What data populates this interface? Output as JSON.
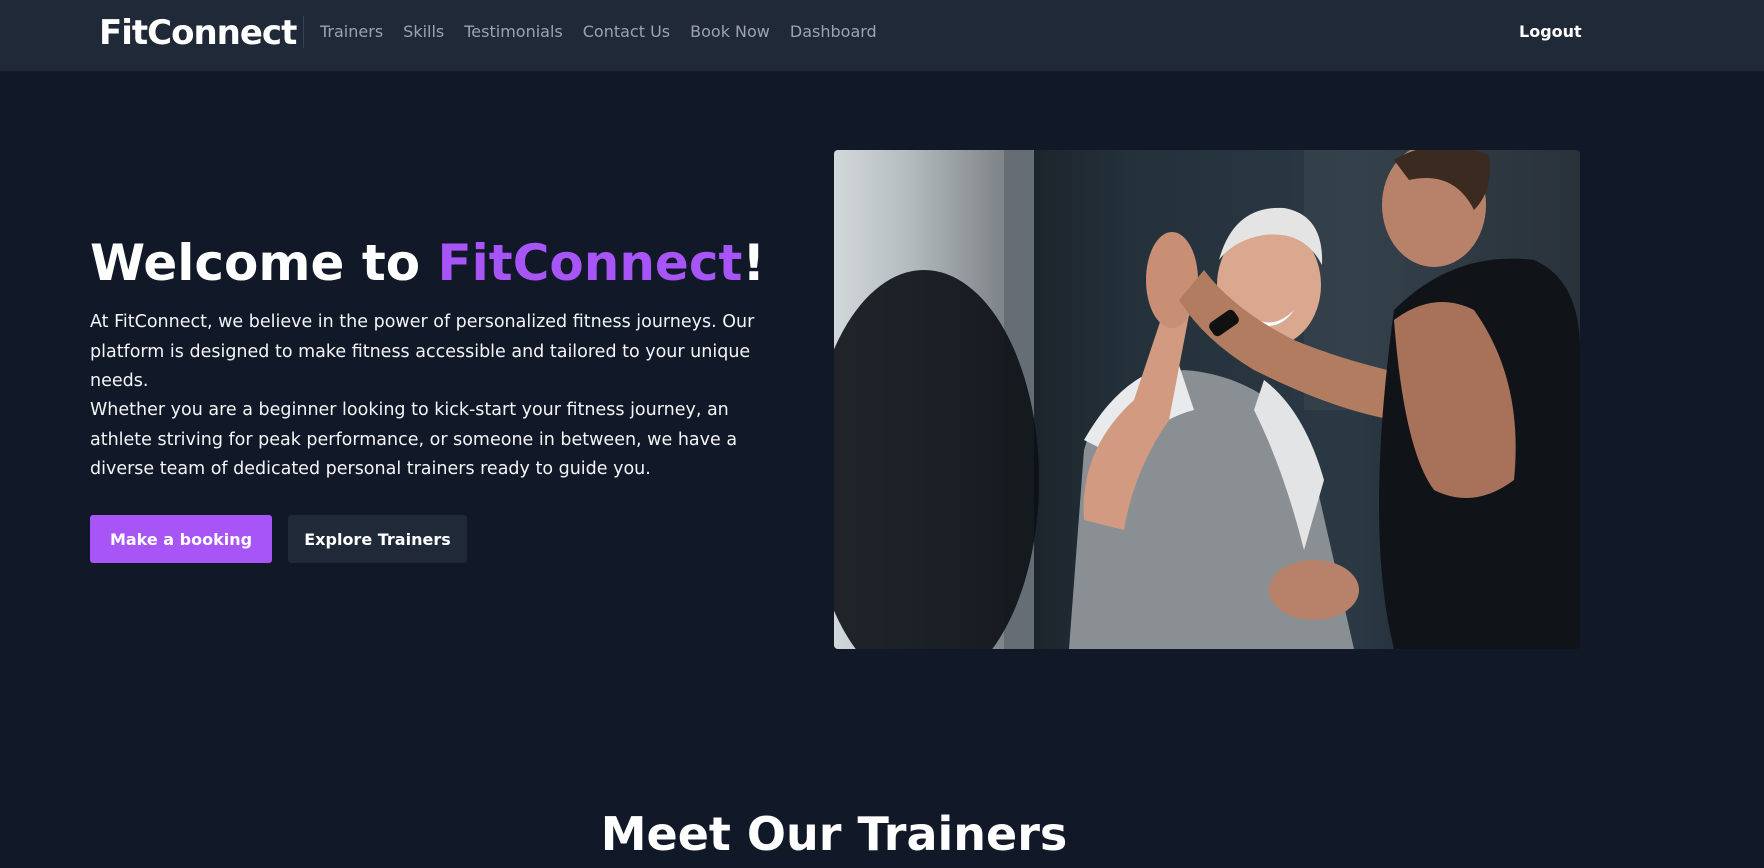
{
  "nav": {
    "brand": "FitConnect",
    "links": [
      "Trainers",
      "Skills",
      "Testimonials",
      "Contact Us",
      "Book Now",
      "Dashboard"
    ],
    "logout": "Logout"
  },
  "hero": {
    "title_prefix": "Welcome to ",
    "title_accent": "FitConnect",
    "title_suffix": "!",
    "paragraph1": "At FitConnect, we believe in the power of personalized fitness journeys. Our platform is designed to make fitness accessible and tailored to your unique needs.",
    "paragraph2": "Whether you are a beginner looking to kick-start your fitness journey, an athlete striving for peak performance, or someone in between, we have a diverse team of dedicated personal trainers ready to guide you.",
    "primary_button": "Make a booking",
    "secondary_button": "Explore Trainers",
    "image_icon": "gym-high-five-photo"
  },
  "section": {
    "title": "Meet Our Trainers"
  },
  "colors": {
    "background": "#111827",
    "navbar": "#1f2937",
    "accent": "#a855f7",
    "muted_text": "#9ca3af"
  }
}
